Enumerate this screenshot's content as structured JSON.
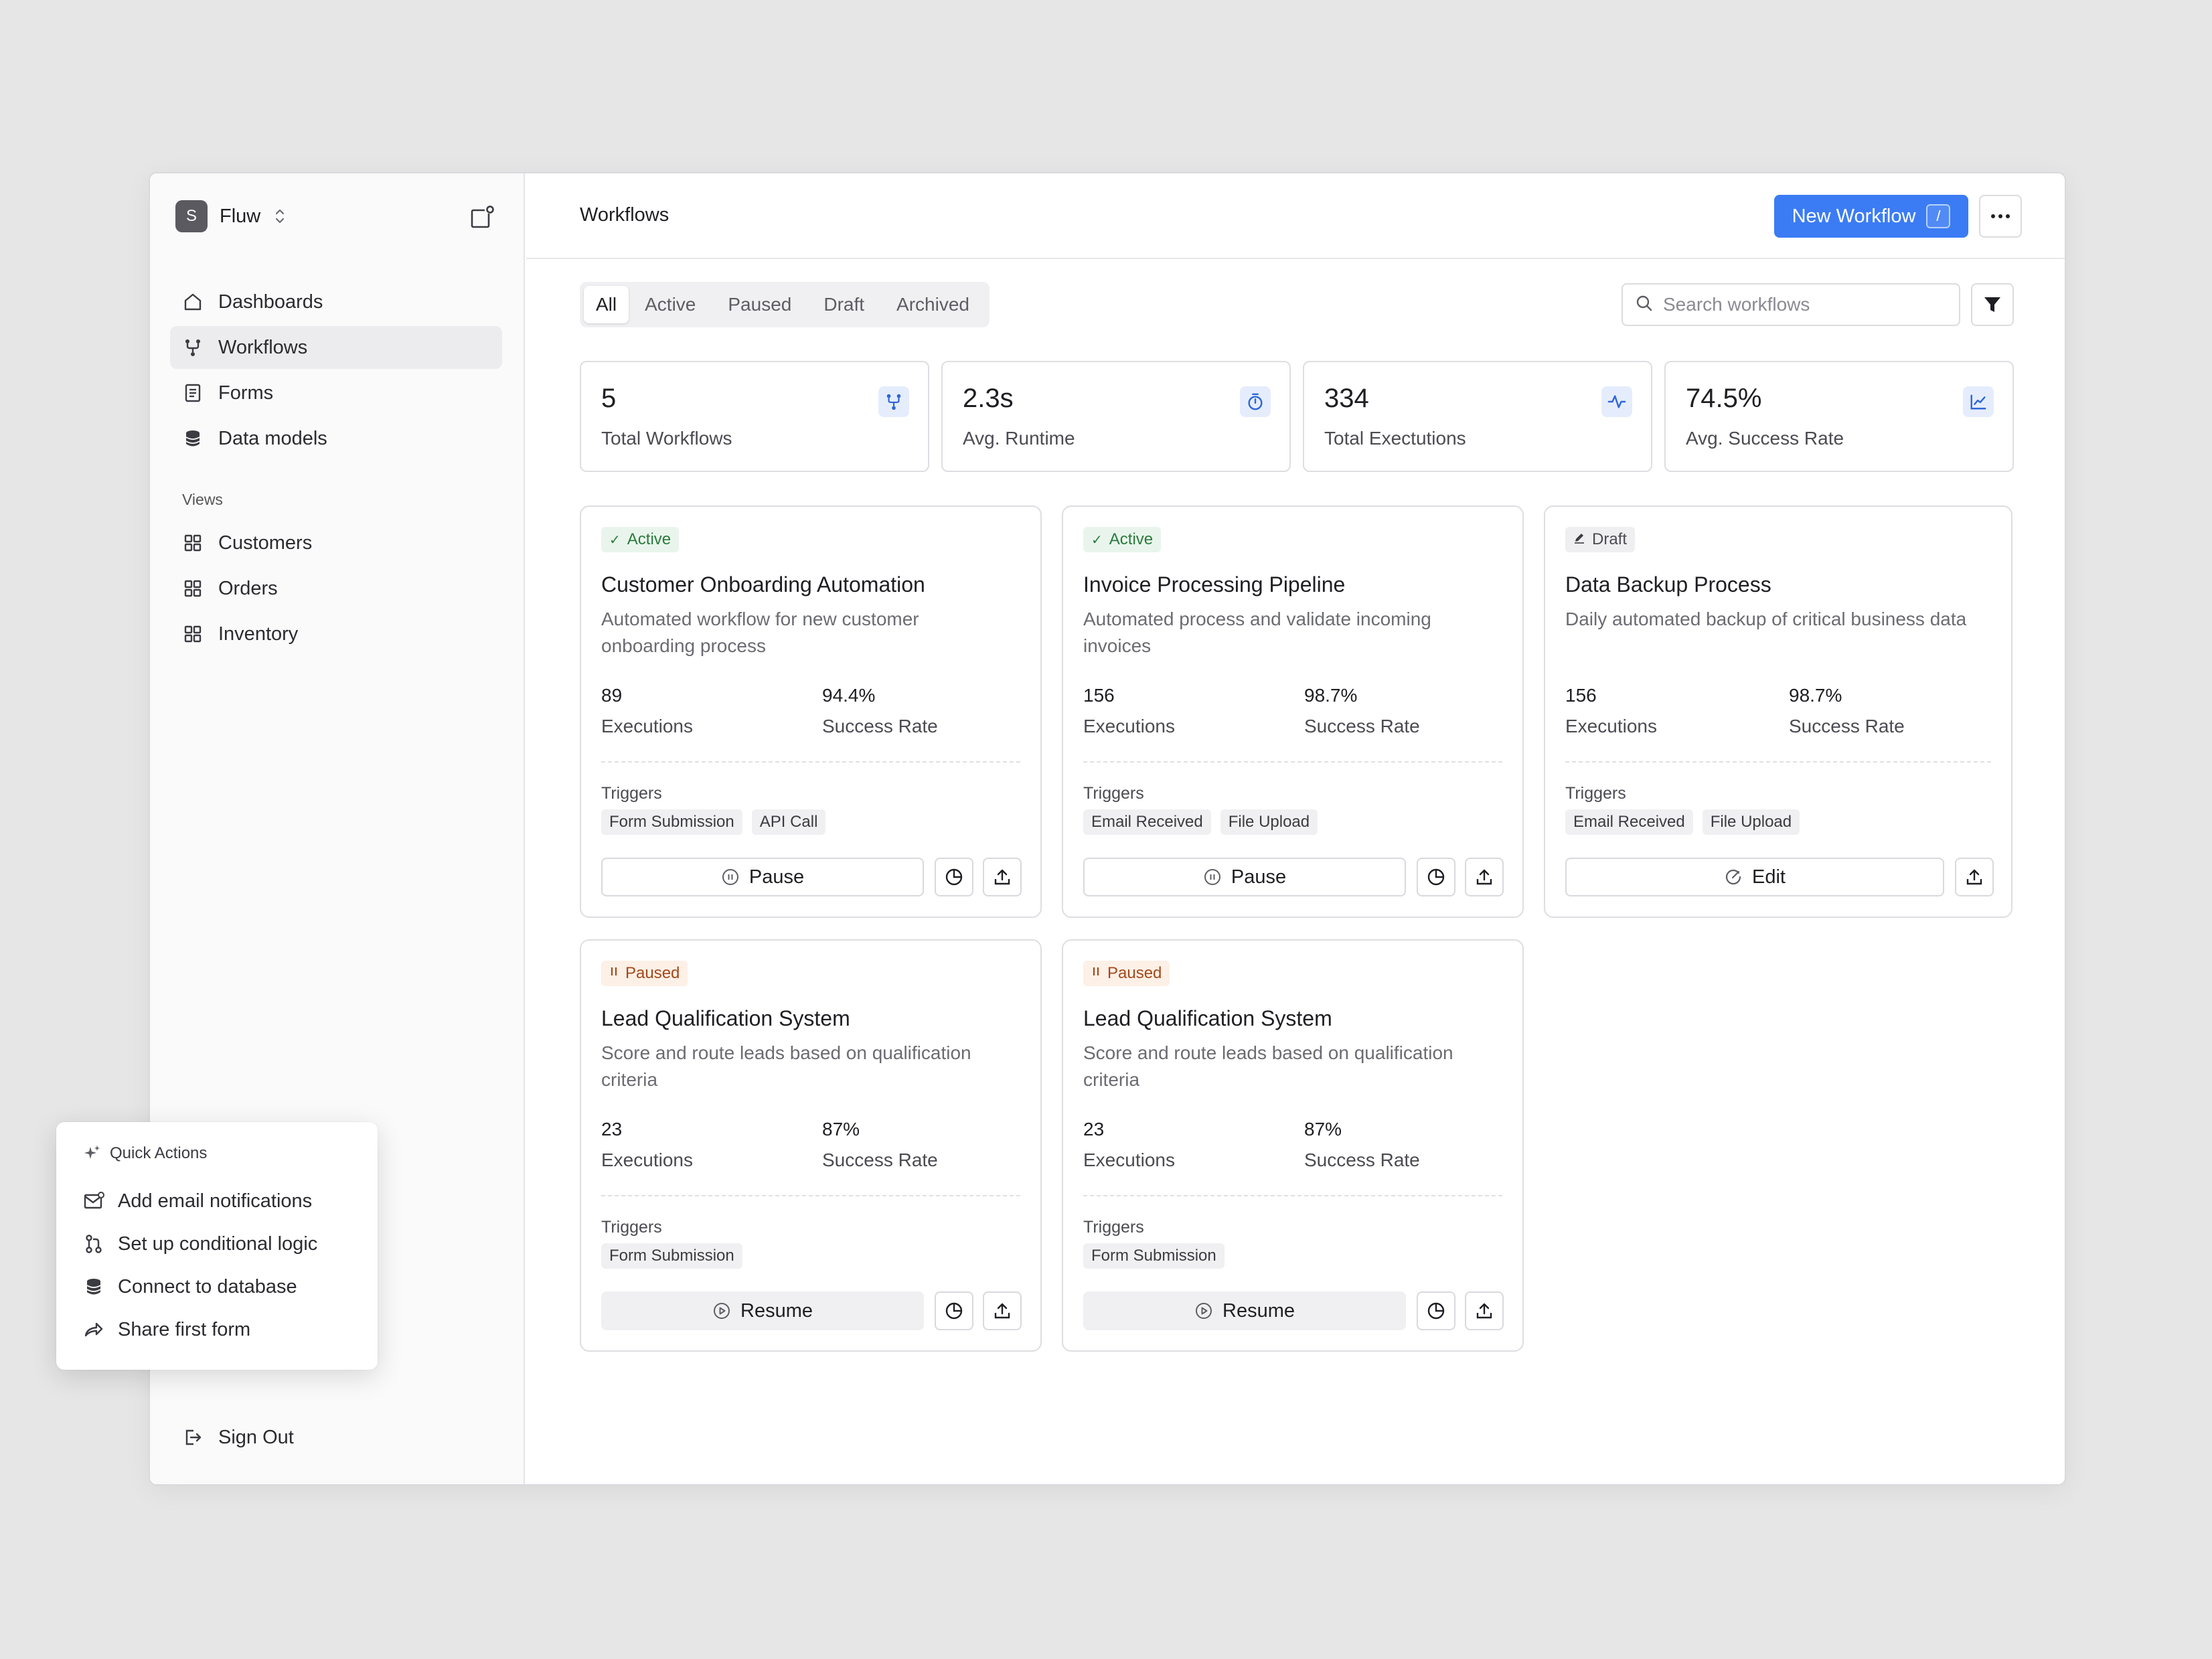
{
  "brand": {
    "initial": "S",
    "name": "Fluw"
  },
  "nav": [
    {
      "label": "Dashboards",
      "icon": "home-icon"
    },
    {
      "label": "Workflows",
      "icon": "workflow-icon",
      "active": true
    },
    {
      "label": "Forms",
      "icon": "form-icon"
    },
    {
      "label": "Data models",
      "icon": "database-icon"
    }
  ],
  "views": {
    "label": "Views",
    "items": [
      {
        "label": "Customers",
        "icon": "grid-icon"
      },
      {
        "label": "Orders",
        "icon": "grid-icon"
      },
      {
        "label": "Inventory",
        "icon": "grid-icon"
      }
    ]
  },
  "signout": "Sign Out",
  "header": {
    "title": "Workflows",
    "new_button": "New Workflow",
    "shortcut": "/"
  },
  "tabs": [
    "All",
    "Active",
    "Paused",
    "Draft",
    "Archived"
  ],
  "search": {
    "placeholder": "Search workflows"
  },
  "stats": [
    {
      "value": "5",
      "label": "Total Workflows",
      "icon": "workflow-icon"
    },
    {
      "value": "2.3s",
      "label": "Avg. Runtime",
      "icon": "stopwatch-icon"
    },
    {
      "value": "334",
      "label": "Total Exectutions",
      "icon": "activity-icon"
    },
    {
      "value": "74.5%",
      "label": "Avg. Success Rate",
      "icon": "line-chart-icon"
    }
  ],
  "cards": [
    {
      "status": "Active",
      "title": "Customer Onboarding Automation",
      "description": "Automated workflow for new customer onboarding process",
      "executions": "89",
      "executions_label": "Executions",
      "success_rate": "94.4%",
      "success_label": "Success Rate",
      "triggers_label": "Triggers",
      "triggers": [
        "Form Submission",
        "API Call"
      ],
      "action": "Pause"
    },
    {
      "status": "Active",
      "title": "Invoice Processing Pipeline",
      "description": "Automated process and validate incoming invoices",
      "executions": "156",
      "executions_label": "Executions",
      "success_rate": "98.7%",
      "success_label": "Success Rate",
      "triggers_label": "Triggers",
      "triggers": [
        "Email Received",
        "File Upload"
      ],
      "action": "Pause"
    },
    {
      "status": "Draft",
      "title": "Data Backup Process",
      "description": "Daily automated backup of critical business data",
      "executions": "156",
      "executions_label": "Executions",
      "success_rate": "98.7%",
      "success_label": "Success Rate",
      "triggers_label": "Triggers",
      "triggers": [
        "Email Received",
        "File Upload"
      ],
      "action": "Edit"
    },
    {
      "status": "Paused",
      "title": "Lead Qualification System",
      "description": "Score and route leads based on qualification criteria",
      "executions": "23",
      "executions_label": "Executions",
      "success_rate": "87%",
      "success_label": "Success Rate",
      "triggers_label": "Triggers",
      "triggers": [
        "Form Submission"
      ],
      "action": "Resume"
    },
    {
      "status": "Paused",
      "title": "Lead Qualification System",
      "description": "Score and route leads based on qualification criteria",
      "executions": "23",
      "executions_label": "Executions",
      "success_rate": "87%",
      "success_label": "Success Rate",
      "triggers_label": "Triggers",
      "triggers": [
        "Form Submission"
      ],
      "action": "Resume"
    }
  ],
  "quick_actions": {
    "title": "Quick Actions",
    "items": [
      {
        "label": "Add email notifications",
        "icon": "mail-icon"
      },
      {
        "label": "Set up conditional logic",
        "icon": "branch-icon"
      },
      {
        "label": "Connect to database",
        "icon": "database-icon"
      },
      {
        "label": "Share first form",
        "icon": "share-icon"
      }
    ]
  },
  "colors": {
    "accent": "#3b7cf4",
    "active": "#2b7a3d",
    "paused": "#a3491b"
  }
}
